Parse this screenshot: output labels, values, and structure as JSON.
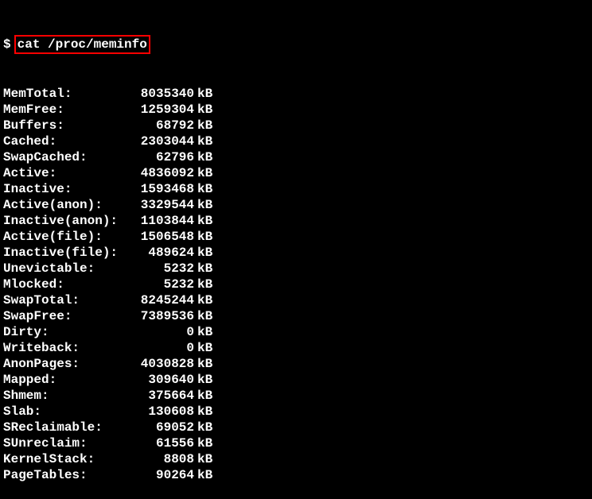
{
  "prompt": "$",
  "command": "cat /proc/meminfo",
  "unit": "kB",
  "rows": [
    {
      "label": "MemTotal:",
      "value": "8035340"
    },
    {
      "label": "MemFree:",
      "value": "1259304"
    },
    {
      "label": "Buffers:",
      "value": "68792"
    },
    {
      "label": "Cached:",
      "value": "2303044"
    },
    {
      "label": "SwapCached:",
      "value": "62796"
    },
    {
      "label": "Active:",
      "value": "4836092"
    },
    {
      "label": "Inactive:",
      "value": "1593468"
    },
    {
      "label": "Active(anon):",
      "value": "3329544"
    },
    {
      "label": "Inactive(anon):",
      "value": "1103844"
    },
    {
      "label": "Active(file):",
      "value": "1506548"
    },
    {
      "label": "Inactive(file):",
      "value": "489624"
    },
    {
      "label": "Unevictable:",
      "value": "5232"
    },
    {
      "label": "Mlocked:",
      "value": "5232"
    },
    {
      "label": "SwapTotal:",
      "value": "8245244"
    },
    {
      "label": "SwapFree:",
      "value": "7389536"
    },
    {
      "label": "Dirty:",
      "value": "0"
    },
    {
      "label": "Writeback:",
      "value": "0"
    },
    {
      "label": "AnonPages:",
      "value": "4030828"
    },
    {
      "label": "Mapped:",
      "value": "309640"
    },
    {
      "label": "Shmem:",
      "value": "375664"
    },
    {
      "label": "Slab:",
      "value": "130608"
    },
    {
      "label": "SReclaimable:",
      "value": "69052"
    },
    {
      "label": "SUnreclaim:",
      "value": "61556"
    },
    {
      "label": "KernelStack:",
      "value": "8808"
    },
    {
      "label": "PageTables:",
      "value": "90264"
    }
  ]
}
